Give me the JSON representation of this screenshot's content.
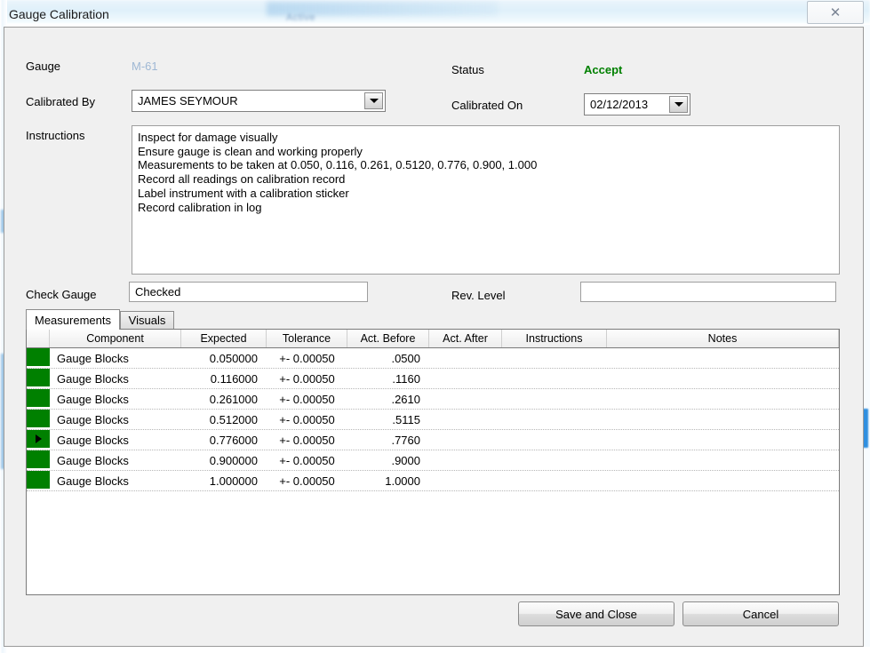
{
  "window": {
    "title": "Gauge Calibration",
    "close_glyph": "✕",
    "close_icon_name": "close-icon"
  },
  "background": {
    "ghost_text": "Active"
  },
  "form": {
    "gauge_label": "Gauge",
    "gauge_value": "M-61",
    "calibrated_by_label": "Calibrated By",
    "calibrated_by_value": "JAMES SEYMOUR",
    "status_label": "Status",
    "status_value": "Accept",
    "calibrated_on_label": "Calibrated On",
    "calibrated_on_value": "02/12/2013",
    "instructions_label": "Instructions",
    "instructions_lines": [
      "Inspect for damage visually",
      "Ensure gauge is clean and working properly",
      "Measurements to be taken at 0.050, 0.116, 0.261, 0.5120, 0.776, 0.900, 1.000",
      "Record all readings on calibration record",
      "Label instrument with a calibration sticker",
      "Record calibration in log"
    ],
    "check_gauge_label": "Check Gauge",
    "check_gauge_value": "Checked",
    "rev_level_label": "Rev. Level",
    "rev_level_value": ""
  },
  "tabs": [
    {
      "label": "Measurements",
      "active": true
    },
    {
      "label": "Visuals",
      "active": false
    }
  ],
  "grid": {
    "columns": [
      "Component",
      "Expected",
      "Tolerance",
      "Act. Before",
      "Act. After",
      "Instructions",
      "Notes"
    ],
    "rows": [
      {
        "selected": false,
        "component": "Gauge Blocks",
        "expected": "0.050000",
        "tolerance": "+- 0.00050",
        "act_before": ".0500",
        "act_after": "",
        "instructions": "",
        "notes": ""
      },
      {
        "selected": false,
        "component": "Gauge Blocks",
        "expected": "0.116000",
        "tolerance": "+- 0.00050",
        "act_before": ".1160",
        "act_after": "",
        "instructions": "",
        "notes": ""
      },
      {
        "selected": false,
        "component": "Gauge Blocks",
        "expected": "0.261000",
        "tolerance": "+- 0.00050",
        "act_before": ".2610",
        "act_after": "",
        "instructions": "",
        "notes": ""
      },
      {
        "selected": false,
        "component": "Gauge Blocks",
        "expected": "0.512000",
        "tolerance": "+- 0.00050",
        "act_before": ".5115",
        "act_after": "",
        "instructions": "",
        "notes": ""
      },
      {
        "selected": true,
        "component": "Gauge Blocks",
        "expected": "0.776000",
        "tolerance": "+- 0.00050",
        "act_before": ".7760",
        "act_after": "",
        "instructions": "",
        "notes": ""
      },
      {
        "selected": false,
        "component": "Gauge Blocks",
        "expected": "0.900000",
        "tolerance": "+- 0.00050",
        "act_before": ".9000",
        "act_after": "",
        "instructions": "",
        "notes": ""
      },
      {
        "selected": false,
        "component": "Gauge Blocks",
        "expected": "1.000000",
        "tolerance": "+- 0.00050",
        "act_before": "1.0000",
        "act_after": "",
        "instructions": "",
        "notes": ""
      }
    ]
  },
  "footer": {
    "save_label": "Save and Close",
    "cancel_label": "Cancel"
  },
  "colors": {
    "status_accept": "#008000",
    "row_marker_green": "#008000",
    "gauge_value": "#9fb8d4",
    "dialog_face": "#f0f0f0"
  }
}
